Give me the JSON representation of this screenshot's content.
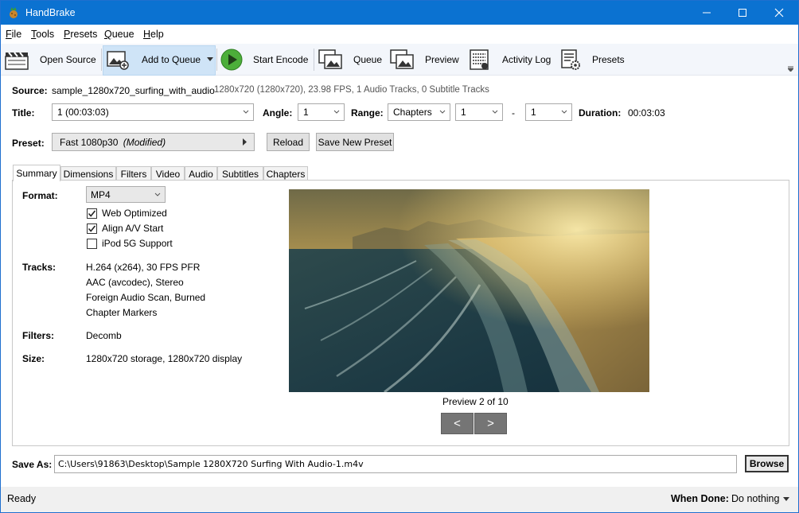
{
  "window": {
    "title": "HandBrake"
  },
  "menu": [
    {
      "key": "F",
      "rest": "ile"
    },
    {
      "key": "T",
      "rest": "ools"
    },
    {
      "key": "P",
      "rest": "resets"
    },
    {
      "key": "Q",
      "rest": "ueue"
    },
    {
      "key": "H",
      "rest": "elp"
    }
  ],
  "toolbar": {
    "open_source": "Open Source",
    "add_to_queue": "Add to Queue",
    "start_encode": "Start Encode",
    "queue": "Queue",
    "preview": "Preview",
    "activity_log": "Activity Log",
    "presets": "Presets"
  },
  "source": {
    "label": "Source:",
    "name": "sample_1280x720_surfing_with_audio",
    "info": "1280x720 (1280x720), 23.98 FPS, 1 Audio Tracks, 0 Subtitle Tracks"
  },
  "title_row": {
    "title_label": "Title:",
    "title_value": "1  (00:03:03)",
    "angle_label": "Angle:",
    "angle_value": "1",
    "range_label": "Range:",
    "range_mode": "Chapters",
    "range_start": "1",
    "range_sep": "-",
    "range_end": "1",
    "duration_label": "Duration:",
    "duration_value": "00:03:03"
  },
  "preset": {
    "label": "Preset:",
    "name": "Fast 1080p30",
    "modified": "(Modified)",
    "reload": "Reload",
    "save_new": "Save New Preset"
  },
  "tabs": [
    "Summary",
    "Dimensions",
    "Filters",
    "Video",
    "Audio",
    "Subtitles",
    "Chapters"
  ],
  "summary": {
    "format_label": "Format:",
    "format_value": "MP4",
    "web_optimized": "Web Optimized",
    "align_av": "Align A/V Start",
    "ipod": "iPod 5G Support",
    "checks": {
      "web_optimized": true,
      "align_av": true,
      "ipod": false
    },
    "tracks_label": "Tracks:",
    "tracks": [
      "H.264 (x264), 30 FPS PFR",
      "AAC (avcodec), Stereo",
      "Foreign Audio Scan, Burned",
      "Chapter Markers"
    ],
    "filters_label": "Filters:",
    "filters_value": "Decomb",
    "size_label": "Size:",
    "size_value": "1280x720 storage, 1280x720 display",
    "preview_caption": "Preview 2 of 10",
    "prev_btn": "<",
    "next_btn": ">"
  },
  "save_as": {
    "label": "Save As:",
    "path": "C:\\Users\\91863\\Desktop\\Sample 1280X720 Surfing With Audio-1.m4v",
    "browse": "Browse"
  },
  "status": {
    "text": "Ready",
    "when_done_label": "When Done:",
    "when_done_value": "Do nothing"
  },
  "colors": {
    "titlebar": "#0b72d1",
    "toolbar_highlight": "#cfe4f7",
    "nav_button": "#757575"
  }
}
